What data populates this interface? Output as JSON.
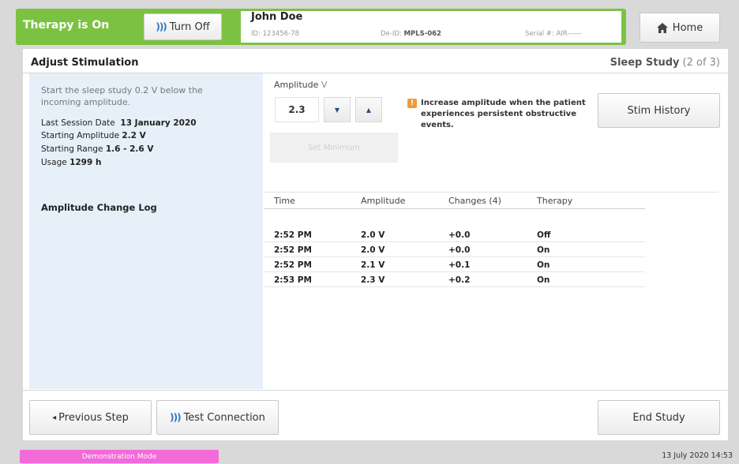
{
  "header": {
    "therapy_status": "Therapy is On",
    "turn_off_label": "Turn Off",
    "patient_name": "John Doe",
    "id_label": "ID:",
    "id_value": "123456-78",
    "de_id_label": "De-ID:",
    "de_id_value": "MPLS-062",
    "serial_label": "Serial #:",
    "serial_value": "AIR------",
    "home_label": "Home",
    "accent_color": "#7cc242"
  },
  "section": {
    "title": "Adjust Stimulation",
    "study_name": "Sleep Study",
    "study_step": "(2 of 3)"
  },
  "left": {
    "instruction": "Start the sleep study 0.2 V below the incoming amplitude.",
    "last_session_label": "Last Session Date",
    "last_session_value": "13 January 2020",
    "starting_amplitude_label": "Starting Amplitude",
    "starting_amplitude_value": "2.2 V",
    "starting_range_label": "Starting Range",
    "starting_range_value": "1.6 - 2.6 V",
    "usage_label": "Usage",
    "usage_value": "1299 h"
  },
  "amplitude": {
    "label": "Amplitude",
    "unit": "V",
    "value": "2.3",
    "decrease_icon": "▼",
    "increase_icon": "▲",
    "set_min_label": "Set Minimum",
    "warning_icon": "!",
    "warning_text": "Increase amplitude when the patient experiences persistent obstructive events."
  },
  "stim_history_label": "Stim History",
  "log": {
    "title": "Amplitude Change Log",
    "columns": [
      "Time",
      "Amplitude",
      "Changes (4)",
      "Therapy"
    ],
    "rows": [
      [
        "2:52 PM",
        "2.0 V",
        "+0.0",
        "Off"
      ],
      [
        "2:52 PM",
        "2.0 V",
        "+0.0",
        "On"
      ],
      [
        "2:52 PM",
        "2.1 V",
        "+0.1",
        "On"
      ],
      [
        "2:53 PM",
        "2.3 V",
        "+0.2",
        "On"
      ]
    ]
  },
  "footer": {
    "previous_label": "Previous Step",
    "previous_icon": "◂",
    "test_connection_label": "Test Connection",
    "end_study_label": "End Study"
  },
  "status_bar": {
    "mode": "Demonstration Mode",
    "datetime": "13 July 2020 14:53",
    "mode_color": "#f36ad9"
  }
}
